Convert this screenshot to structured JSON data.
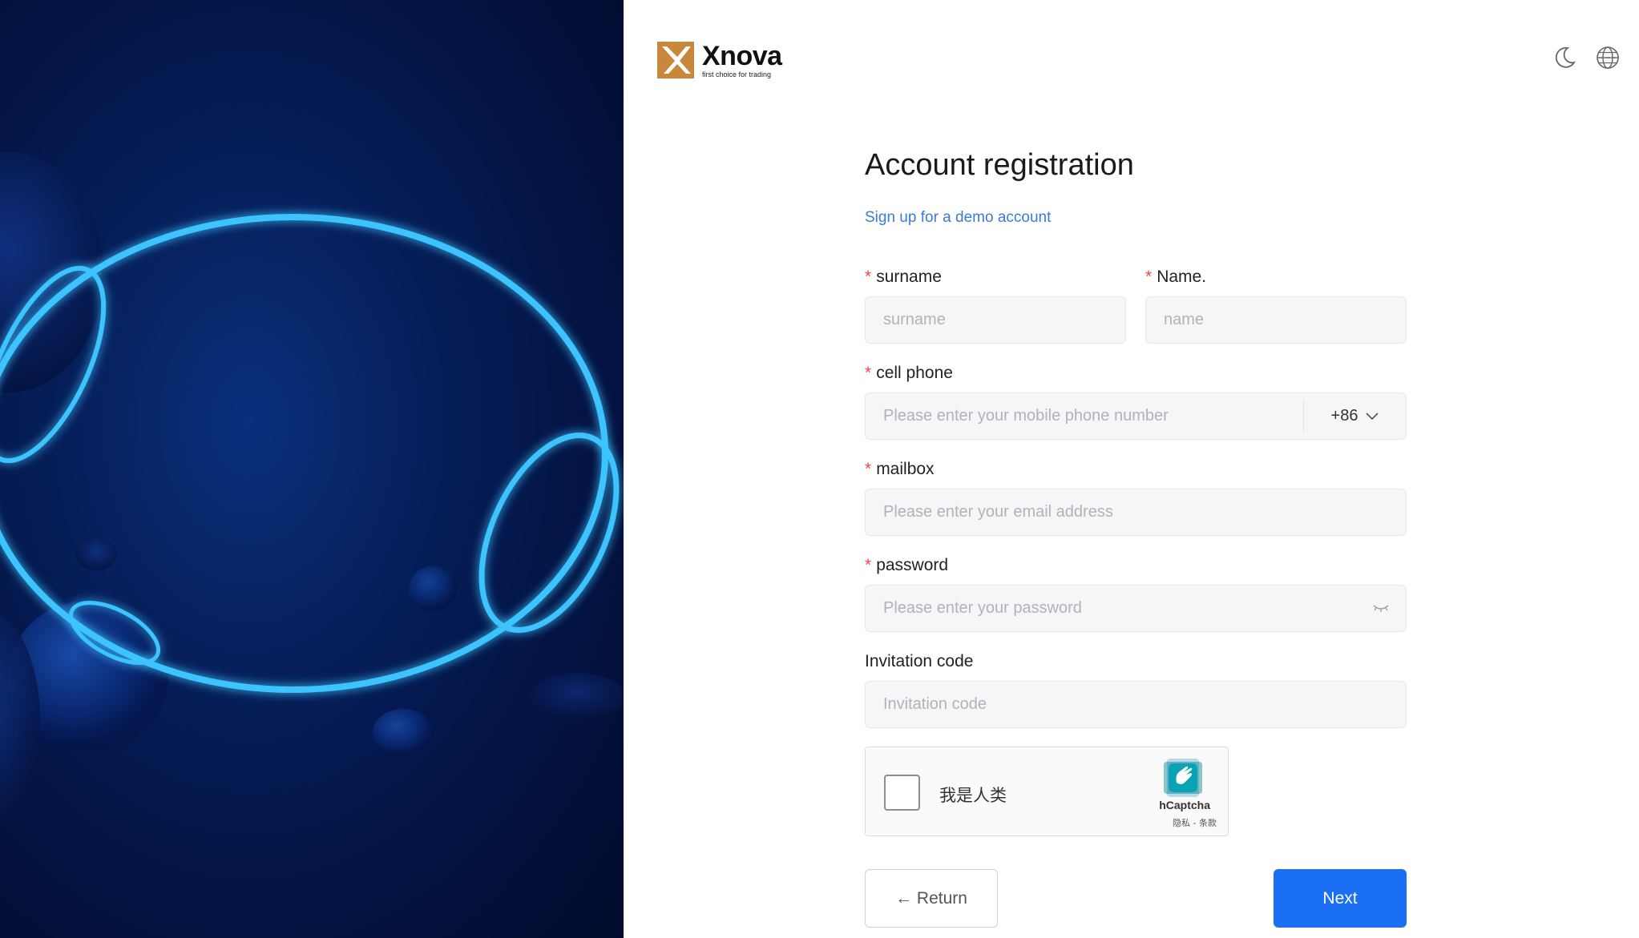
{
  "brand": {
    "name": "Xnova",
    "tagline": "first choice for trading",
    "logo_color": "#c8873a"
  },
  "header": {
    "icons": [
      "moon-icon",
      "globe-icon"
    ]
  },
  "form": {
    "title": "Account registration",
    "subtitle_link": "Sign up for a demo account",
    "required_mark": "*",
    "surname": {
      "label": "surname",
      "placeholder": "surname"
    },
    "name": {
      "label": "Name.",
      "placeholder": "name"
    },
    "phone": {
      "label": "cell phone",
      "placeholder": "Please enter your mobile phone number",
      "country_code": "+86"
    },
    "mailbox": {
      "label": "mailbox",
      "placeholder": "Please enter your email address"
    },
    "password": {
      "label": "password",
      "placeholder": "Please enter your password"
    },
    "invitation": {
      "label": "Invitation code",
      "placeholder": "Invitation code"
    },
    "captcha": {
      "label": "我是人类",
      "provider": "hCaptcha",
      "links": "隐私 - 条款"
    },
    "buttons": {
      "return": "← Return",
      "next": "Next"
    }
  },
  "colors": {
    "accent": "#1a6ff2",
    "link": "#3a7bd5",
    "required": "#e5484d",
    "hero_bg": "#031343",
    "neon": "#3cc4ff"
  }
}
